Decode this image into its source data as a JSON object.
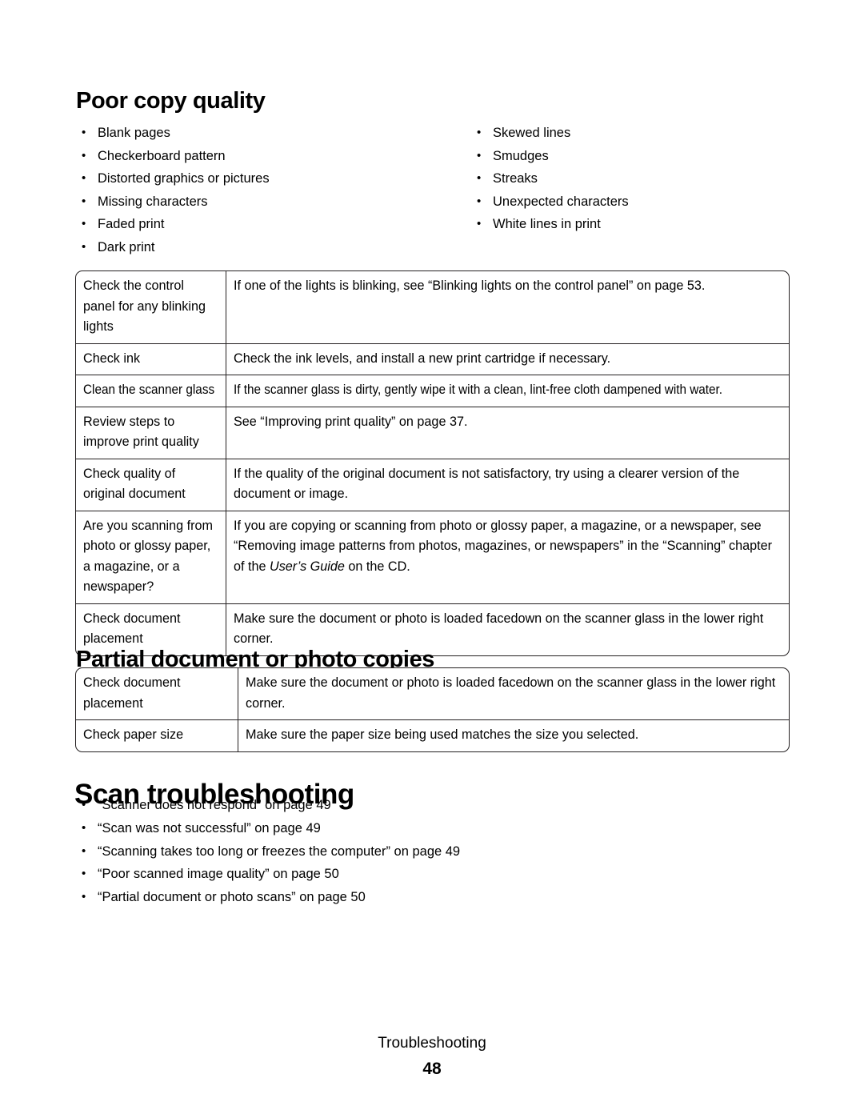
{
  "page": {
    "footer_label": "Troubleshooting",
    "footer_page_number": "48"
  },
  "sections": {
    "poor_copy_quality": {
      "heading": "Poor copy quality",
      "symptoms_left": [
        "Blank pages",
        "Checkerboard pattern",
        "Distorted graphics or pictures",
        "Missing characters",
        "Faded print",
        "Dark print"
      ],
      "symptoms_right": [
        "Skewed lines",
        "Smudges",
        "Streaks",
        "Unexpected characters",
        "White lines in print"
      ],
      "table": [
        {
          "key": "Check the control panel for any blinking lights",
          "value": "If one of the lights is blinking, see “Blinking lights on the control panel” on page 53."
        },
        {
          "key": "Check ink",
          "value": "Check the ink levels, and install a new print cartridge if necessary."
        },
        {
          "key": "Clean the scanner glass",
          "value": "If the scanner glass is dirty, gently wipe it with a clean, lint-free cloth dampened with water."
        },
        {
          "key": "Review steps to improve print quality",
          "value": "See “Improving print quality” on page 37."
        },
        {
          "key": "Check quality of original document",
          "value": "If the quality of the original document is not satisfactory, try using a clearer version of the document or image."
        },
        {
          "key": "Are you scanning from photo or glossy paper, a magazine, or a newspaper?",
          "value_part1": "If you are copying or scanning from photo or glossy paper, a magazine, or a newspaper, see “Removing image patterns from photos, magazines, or newspapers” in the “Scanning” chapter of the ",
          "value_italic": "User’s Guide",
          "value_part2": " on the CD."
        },
        {
          "key": "Check document placement",
          "value": "Make sure the document or photo is loaded facedown on the scanner glass in the lower right corner."
        }
      ]
    },
    "partial_document": {
      "heading": "Partial document or photo copies",
      "table": [
        {
          "key": "Check document placement",
          "value": "Make sure the document or photo is loaded facedown on the scanner glass in the lower right corner."
        },
        {
          "key": "Check paper size",
          "value": "Make sure the paper size being used matches the size you selected."
        }
      ]
    },
    "scan_troubleshooting": {
      "heading": "Scan troubleshooting",
      "links": [
        "“Scanner does not respond” on page 49",
        "“Scan was not successful” on page 49",
        "“Scanning takes too long or freezes the computer” on page 49",
        "“Poor scanned image quality” on page 50",
        "“Partial document or photo scans” on page 50"
      ]
    }
  },
  "icons": {
    "bullet": "•"
  }
}
